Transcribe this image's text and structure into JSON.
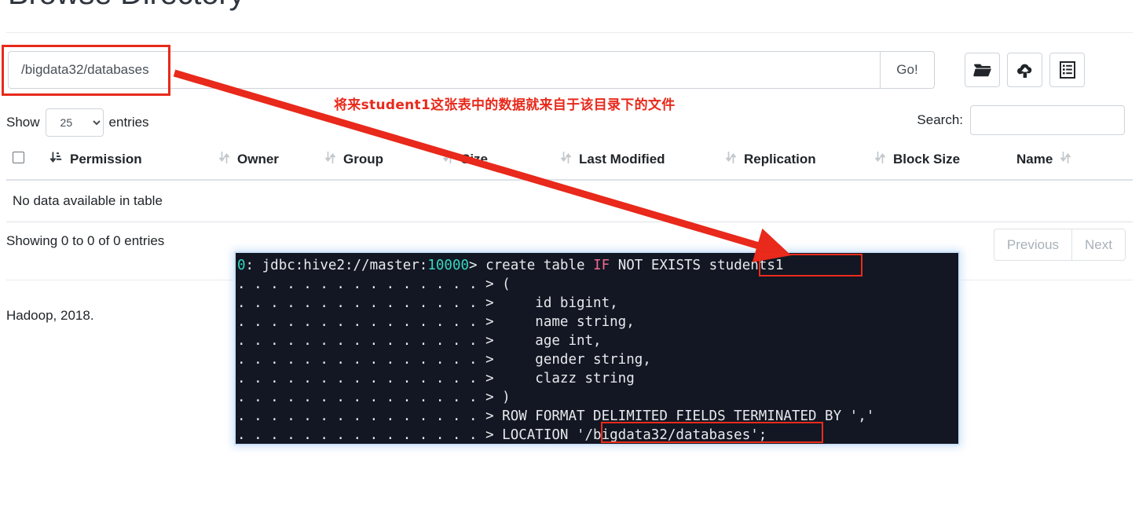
{
  "page": {
    "title": "Browse Directory",
    "footer": "Hadoop, 2018."
  },
  "path_bar": {
    "value": "/bigdata32/databases",
    "placeholder": "",
    "go_label": "Go!",
    "buttons": [
      {
        "name": "folder-icon",
        "title": "Create Directory"
      },
      {
        "name": "cloud-upload-icon",
        "title": "Upload Files"
      },
      {
        "name": "list-icon",
        "title": "Cut & Paste"
      }
    ]
  },
  "annotation": {
    "text": "将来student1这张表中的数据就来自于该目录下的文件",
    "color": "#e8291b",
    "arrow_color": "#e8291b",
    "highlight_color": "#ee2b1c"
  },
  "controls": {
    "show_label": "Show",
    "entries_label": "entries",
    "entries_value": "25",
    "entries_options": [
      "25"
    ],
    "search_label": "Search:",
    "search_value": "",
    "search_placeholder": ""
  },
  "table": {
    "columns": [
      "Permission",
      "Owner",
      "Group",
      "Size",
      "Last Modified",
      "Replication",
      "Block Size",
      "Name"
    ],
    "empty_message": "No data available in table",
    "rows": []
  },
  "pagination": {
    "showing": "Showing 0 to 0 of 0 entries",
    "previous": "Previous",
    "next": "Next"
  },
  "terminal": {
    "prompt_id": "0",
    "prompt_host": ": jdbc:hive2://master:",
    "prompt_port": "10000",
    "prompt_tail": "> ",
    "cont_prompt": ". . . . . . . . . . . . . . . > ",
    "line1_a": "create table ",
    "line1_if": "IF",
    "line1_b": " NOT EXISTS students1",
    "lines": [
      "(",
      "    id bigint,",
      "    name string,",
      "    age int,",
      "    gender string,",
      "    clazz string",
      ")",
      "ROW FORMAT DELIMITED FIELDS TERMINATED BY ','",
      "LOCATION '/bigdata32/databases';"
    ]
  }
}
